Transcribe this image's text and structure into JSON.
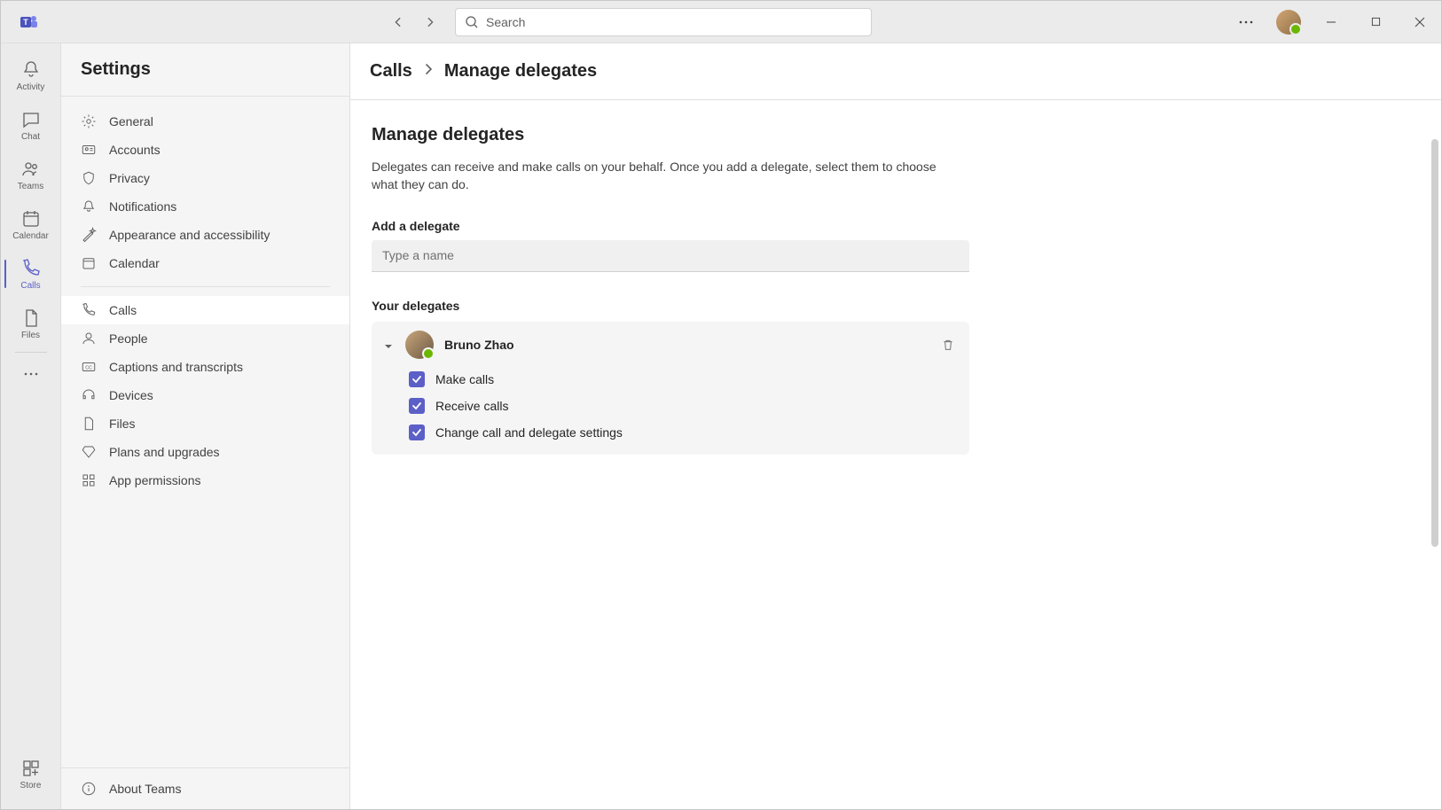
{
  "app": {
    "search_placeholder": "Search"
  },
  "rail": {
    "activity": "Activity",
    "chat": "Chat",
    "teams": "Teams",
    "calendar": "Calendar",
    "calls": "Calls",
    "files": "Files",
    "store": "Store"
  },
  "settings": {
    "title": "Settings",
    "items": {
      "general": "General",
      "accounts": "Accounts",
      "privacy": "Privacy",
      "notifications": "Notifications",
      "appearance": "Appearance and accessibility",
      "calendar": "Calendar",
      "calls": "Calls",
      "people": "People",
      "captions": "Captions and transcripts",
      "devices": "Devices",
      "files": "Files",
      "plans": "Plans and upgrades",
      "permissions": "App permissions"
    },
    "about": "About Teams"
  },
  "breadcrumb": {
    "root": "Calls",
    "current": "Manage delegates"
  },
  "page": {
    "title": "Manage delegates",
    "description": "Delegates can receive and make calls on your behalf. Once you add a delegate, select them to choose what they can do.",
    "add_label": "Add a delegate",
    "add_placeholder": "Type a name",
    "your_delegates_label": "Your delegates"
  },
  "delegate": {
    "name": "Bruno Zhao",
    "permissions": {
      "make": "Make calls",
      "receive": "Receive calls",
      "change": "Change call and delegate settings"
    }
  }
}
